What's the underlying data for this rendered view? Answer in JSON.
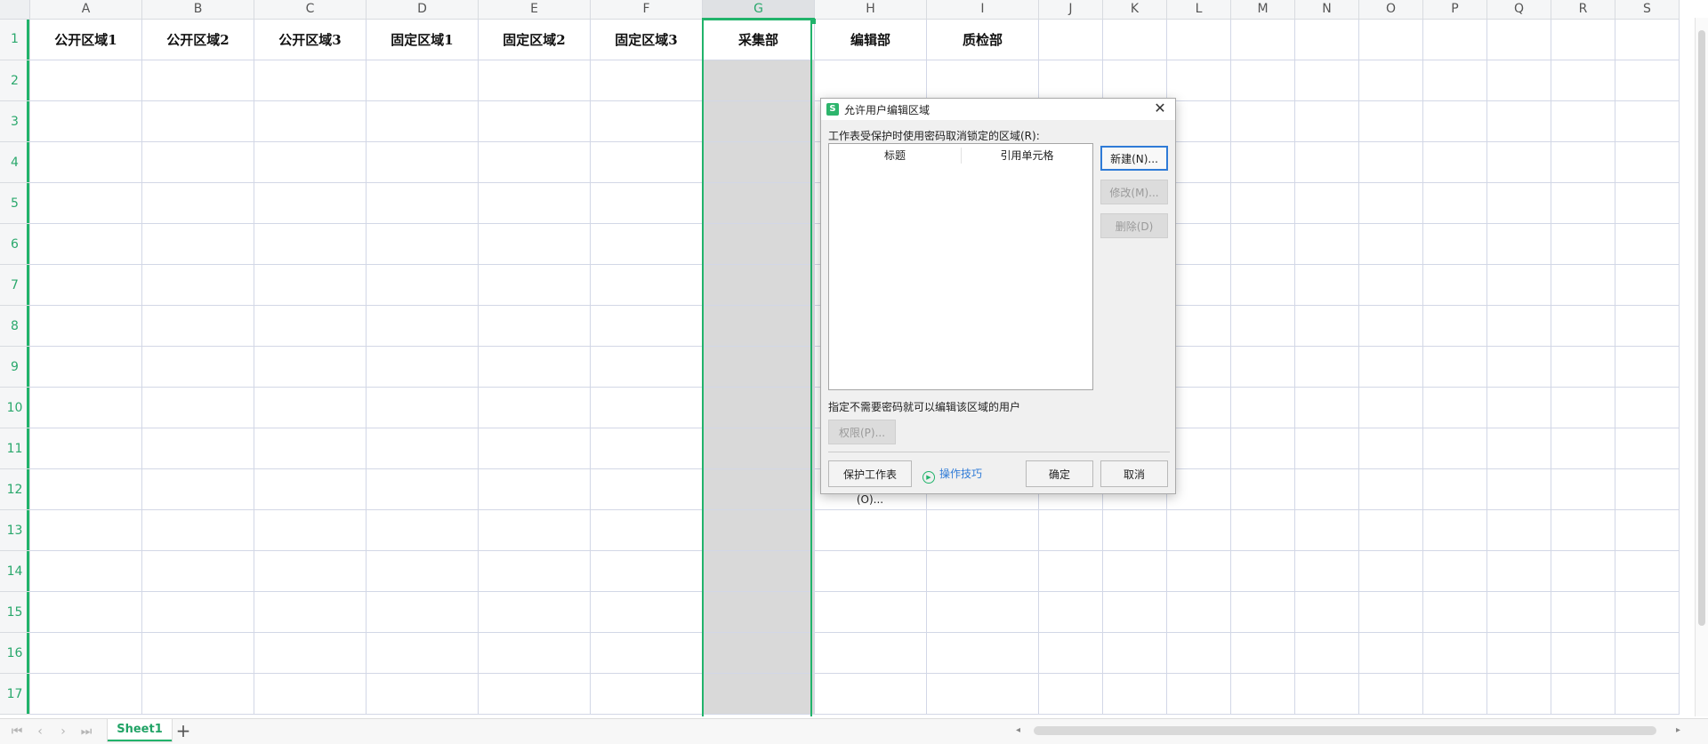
{
  "sheet": {
    "columns": [
      "A",
      "B",
      "C",
      "D",
      "E",
      "F",
      "G",
      "H",
      "I",
      "J",
      "K",
      "L",
      "M",
      "N",
      "O",
      "P",
      "Q",
      "R",
      "S"
    ],
    "rows": [
      "1",
      "2",
      "3",
      "4",
      "5",
      "6",
      "7",
      "8",
      "9",
      "10",
      "11",
      "12",
      "13",
      "14",
      "15",
      "16",
      "17"
    ],
    "row1_values": [
      "公开区域1",
      "公开区域2",
      "公开区域3",
      "固定区域1",
      "固定区域2",
      "固定区域3",
      "采集部",
      "编辑部",
      "质检部",
      "",
      "",
      "",
      "",
      "",
      "",
      "",
      "",
      "",
      ""
    ],
    "selected_column": "G"
  },
  "bottom": {
    "sheet_tab": "Sheet1",
    "add_sheet": "+",
    "nav": [
      "⏮",
      "‹",
      "›",
      "⏭"
    ]
  },
  "dialog": {
    "title": "允许用户编辑区域",
    "logo": "S",
    "close": "✕",
    "description": "工作表受保护时使用密码取消锁定的区域(R):",
    "list_headers": [
      "标题",
      "引用单元格"
    ],
    "btn_new": "新建(N)...",
    "btn_modify": "修改(M)...",
    "btn_delete": "删除(D)",
    "users_label": "指定不需要密码就可以编辑该区域的用户",
    "btn_permission": "权限(P)...",
    "btn_protect": "保护工作表(O)...",
    "tips": "操作技巧",
    "btn_ok": "确定",
    "btn_cancel": "取消"
  },
  "colors": {
    "accent": "#21b36b",
    "link": "#2f7bd7",
    "selected_fill": "#d9d9d9"
  }
}
